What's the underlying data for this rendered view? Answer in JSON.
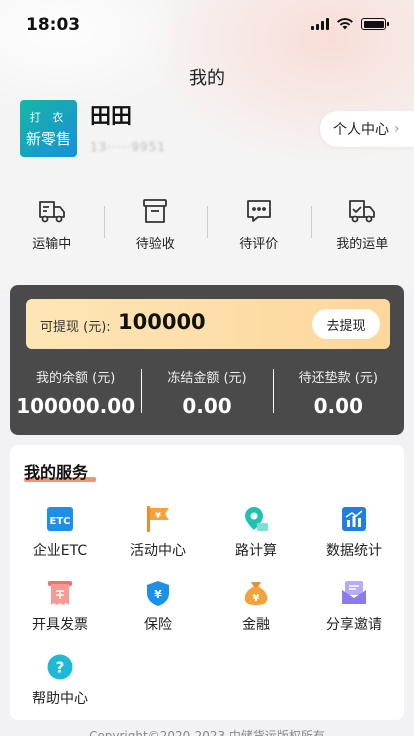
{
  "status_bar": {
    "time": "18:03"
  },
  "header": {
    "title": "我的"
  },
  "user": {
    "logo_line1": "打 衣",
    "logo_line2": "新零售",
    "name": "田田",
    "phone": "13·····9951",
    "personal_center": "个人中心"
  },
  "waybill": {
    "items": [
      {
        "label": "运输中",
        "icon": "truck-icon"
      },
      {
        "label": "待验收",
        "icon": "box-icon"
      },
      {
        "label": "待评价",
        "icon": "comment-icon"
      },
      {
        "label": "我的运单",
        "icon": "truck-check-icon"
      }
    ]
  },
  "wallet": {
    "withdrawable_label": "可提现 (元):",
    "withdrawable_value": "100000",
    "withdraw_button": "去提现",
    "stats": [
      {
        "label": "我的余额 (元)",
        "value": "100000.00"
      },
      {
        "label": "冻结金额 (元)",
        "value": "0.00"
      },
      {
        "label": "待还垫款 (元)",
        "value": "0.00"
      }
    ]
  },
  "services": {
    "title": "我的服务",
    "items": [
      {
        "label": "企业ETC",
        "icon": "etc-icon"
      },
      {
        "label": "活动中心",
        "icon": "flag-icon"
      },
      {
        "label": "路计算",
        "icon": "map-pin-icon"
      },
      {
        "label": "数据统计",
        "icon": "chart-icon"
      },
      {
        "label": "开具发票",
        "icon": "invoice-icon"
      },
      {
        "label": "保险",
        "icon": "shield-icon"
      },
      {
        "label": "金融",
        "icon": "money-bag-icon"
      },
      {
        "label": "分享邀请",
        "icon": "mail-icon"
      },
      {
        "label": "帮助中心",
        "icon": "help-icon"
      }
    ]
  },
  "footer": {
    "text": "Copyright©2020-2023 中储货运版权所有"
  },
  "colors": {
    "etc_blue": "#1e8fe6",
    "orange": "#f6a23c",
    "teal": "#1fc2b0",
    "red": "#f4706a",
    "purple": "#8a7cf0",
    "wallet_bg": "#4a4a4a",
    "accent_underline": "#f2876a"
  }
}
